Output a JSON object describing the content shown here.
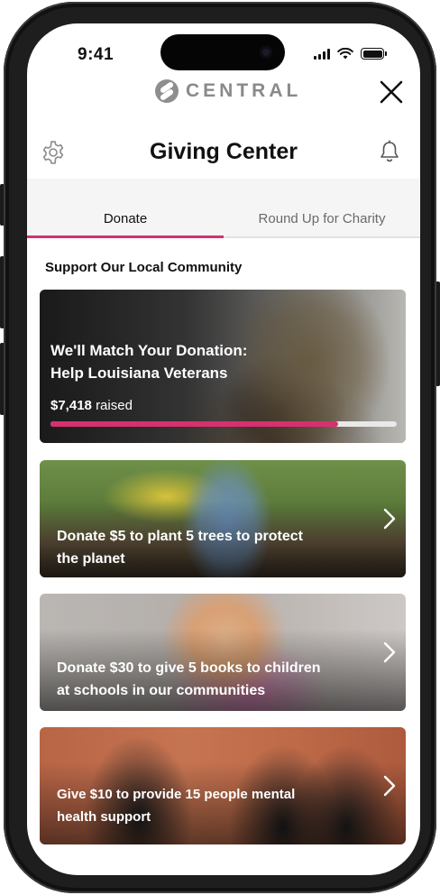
{
  "status_bar": {
    "time": "9:41"
  },
  "brand": {
    "name": "CENTRAL"
  },
  "header": {
    "title": "Giving Center"
  },
  "tabs": [
    {
      "label": "Donate",
      "active": true
    },
    {
      "label": "Round Up for Charity",
      "active": false
    }
  ],
  "section": {
    "title": "Support Our Local Community"
  },
  "featured": {
    "title_line1": "We'll Match Your Donation:",
    "title_line2": "Help Louisiana Veterans",
    "amount": "$7,418",
    "raised_label": "raised",
    "progress_fraction": 0.83
  },
  "campaigns": [
    {
      "line1": "Donate $5 to plant 5 trees to protect",
      "line2": "the planet"
    },
    {
      "line1": "Donate $30 to give 5 books to children",
      "line2": "at schools in our communities"
    },
    {
      "line1": "Give $10 to provide 15 people mental",
      "line2": "health support"
    }
  ],
  "colors": {
    "accent": "#d8306e",
    "brand_gray": "#8a8a8a",
    "tab_background": "#f5f5f5"
  },
  "icons": [
    "close-icon",
    "gear-icon",
    "bell-icon",
    "chevron-right-icon",
    "central-logo-icon"
  ]
}
